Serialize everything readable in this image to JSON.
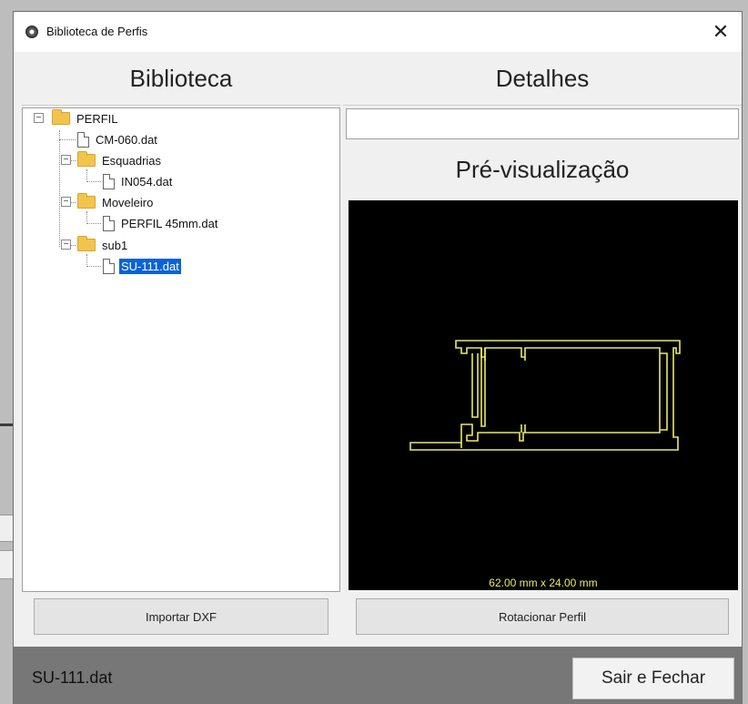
{
  "window": {
    "title": "Biblioteca de Perfis",
    "close_glyph": "✕"
  },
  "library": {
    "header": "Biblioteca",
    "tree": [
      {
        "label": "PERFIL",
        "type": "folder",
        "level": 0
      },
      {
        "label": "CM-060.dat",
        "type": "file",
        "level": 1
      },
      {
        "label": "Esquadrias",
        "type": "folder",
        "level": 1
      },
      {
        "label": "IN054.dat",
        "type": "file",
        "level": 2
      },
      {
        "label": "Moveleiro",
        "type": "folder",
        "level": 1
      },
      {
        "label": "PERFIL 45mm.dat",
        "type": "file",
        "level": 2
      },
      {
        "label": "sub1",
        "type": "folder",
        "level": 1
      },
      {
        "label": "SU-111.dat",
        "type": "file",
        "level": 2,
        "selected": true
      }
    ],
    "import_button": "Importar DXF"
  },
  "details": {
    "header": "Detalhes",
    "field_value": "",
    "preview_title": "Pré-visualização",
    "dimensions": "62.00 mm  x  24.00 mm",
    "rotate_button": "Rotacionar Perfil"
  },
  "status": {
    "selected_file": "SU-111.dat",
    "exit_button": "Sair e Fechar"
  },
  "colors": {
    "selection": "#0a63d6",
    "profile_stroke": "#e8e86a",
    "preview_bg": "#000000",
    "statusbar_bg": "#777777"
  }
}
